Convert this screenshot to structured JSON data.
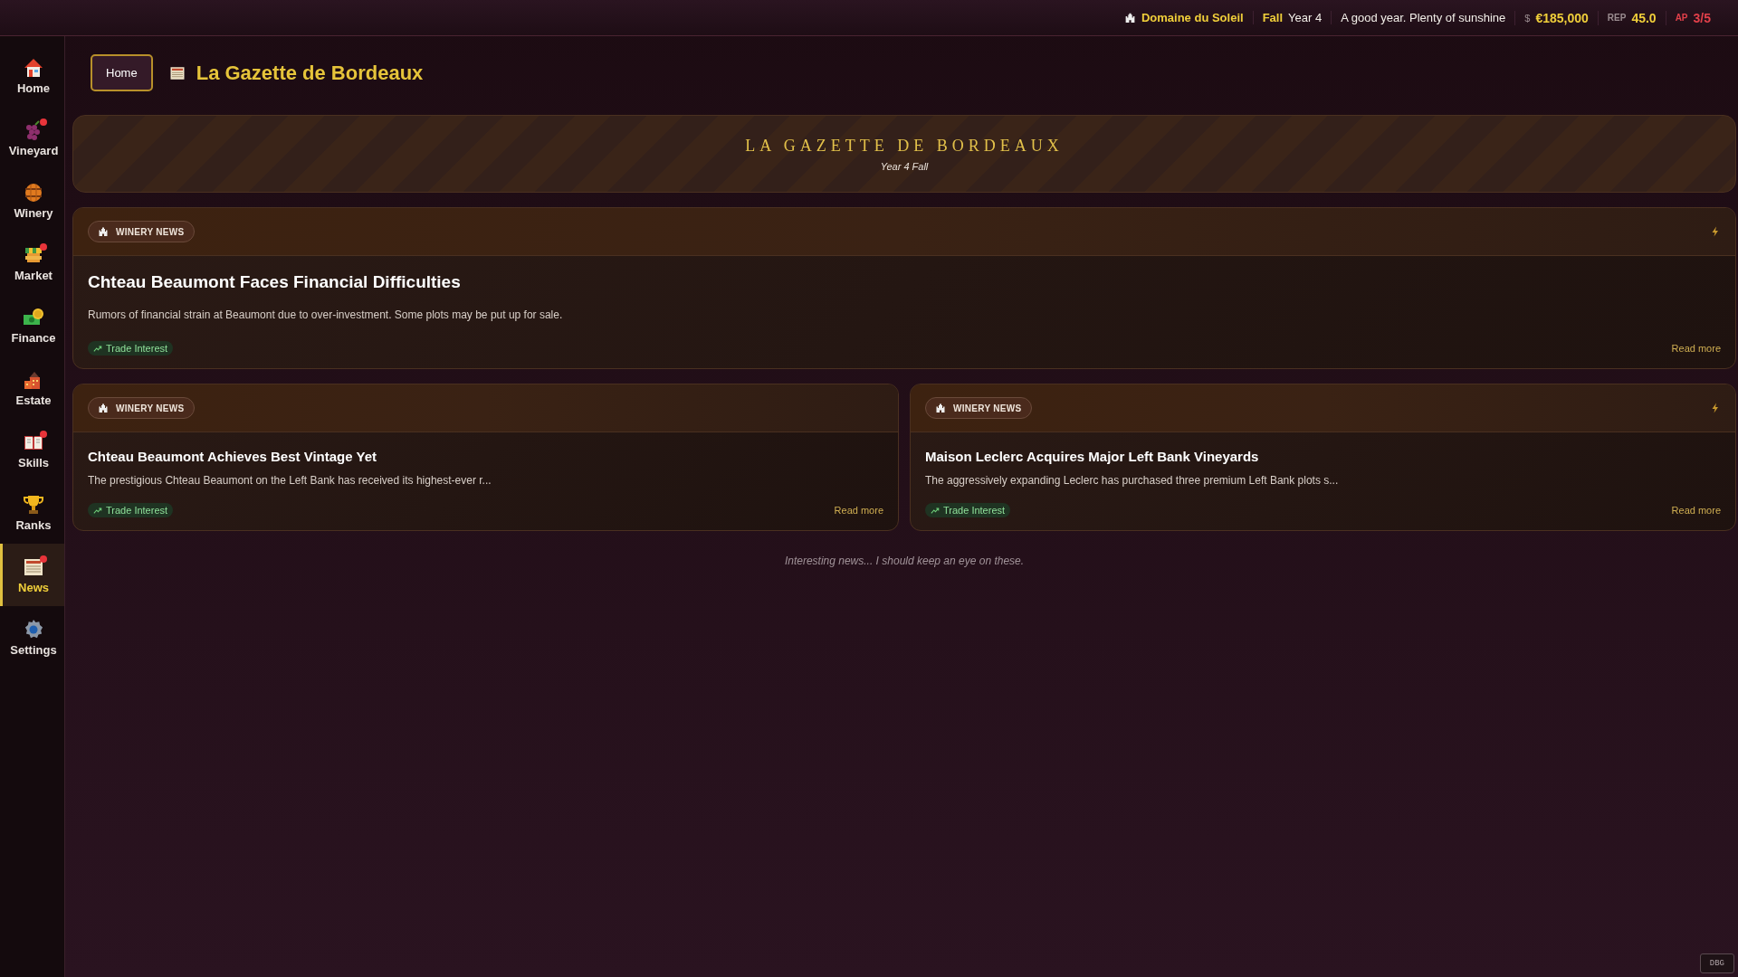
{
  "top_bar": {
    "estate": "Domaine du Soleil",
    "season": "Fall",
    "year": "Year 4",
    "weather": "A good year. Plenty of sunshine",
    "money_symbol": "$",
    "money": "€185,000",
    "rep_label": "REP",
    "rep": "45.0",
    "ap_label": "AP",
    "ap": "3/5"
  },
  "sidebar": {
    "items": [
      {
        "label": "Home",
        "selected": false,
        "alert": false
      },
      {
        "label": "Vineyard",
        "selected": false,
        "alert": true
      },
      {
        "label": "Winery",
        "selected": false,
        "alert": false
      },
      {
        "label": "Market",
        "selected": false,
        "alert": true
      },
      {
        "label": "Finance",
        "selected": false,
        "alert": false
      },
      {
        "label": "Estate",
        "selected": false,
        "alert": false
      },
      {
        "label": "Skills",
        "selected": false,
        "alert": true
      },
      {
        "label": "Ranks",
        "selected": false,
        "alert": false
      },
      {
        "label": "News",
        "selected": true,
        "alert": true
      },
      {
        "label": "Settings",
        "selected": false,
        "alert": false
      }
    ]
  },
  "header": {
    "breadcrumb": "Home",
    "title": "La Gazette de Bordeaux"
  },
  "banner": {
    "title": "LA GAZETTE DE BORDEAUX",
    "subtitle": "Year 4 Fall"
  },
  "articles": [
    {
      "category": "WINERY NEWS",
      "headline": "Chteau Beaumont Faces Financial Difficulties",
      "summary": "Rumors of financial strain at Beaumont due to over-investment. Some plots may be put up for sale.",
      "tag": "Trade Interest",
      "read_more": "Read more",
      "urgent": true,
      "featured": true
    },
    {
      "category": "WINERY NEWS",
      "headline": "Chteau Beaumont Achieves Best Vintage Yet",
      "summary": "The prestigious Chteau Beaumont on the Left Bank has received its highest-ever r...",
      "tag": "Trade Interest",
      "read_more": "Read more",
      "urgent": false,
      "featured": false
    },
    {
      "category": "WINERY NEWS",
      "headline": "Maison Leclerc Acquires Major Left Bank Vineyards",
      "summary": "The aggressively expanding Leclerc has purchased three premium Left Bank plots s...",
      "tag": "Trade Interest",
      "read_more": "Read more",
      "urgent": true,
      "featured": false
    }
  ],
  "footnote": "Interesting news... I should keep an eye on these.",
  "debug_button": "DBG"
}
